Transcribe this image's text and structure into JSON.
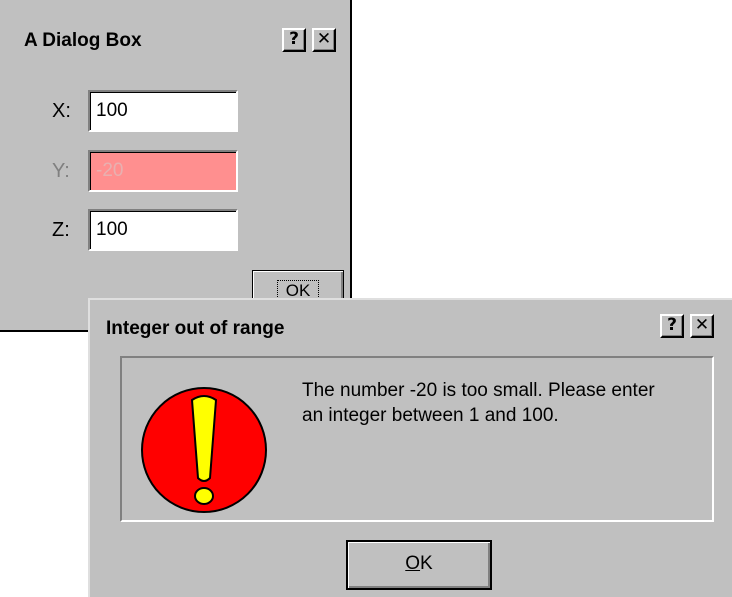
{
  "dialog_main": {
    "title": "A Dialog Box",
    "help_label": "?",
    "close_label": "✕",
    "fields": [
      {
        "label": "X:",
        "value": "100",
        "state": "normal"
      },
      {
        "label": "Y:",
        "value": "-20",
        "state": "error"
      },
      {
        "label": "Z:",
        "value": "100",
        "state": "normal"
      }
    ],
    "ok_label": "OK"
  },
  "error_dialog": {
    "title": "Integer out of range",
    "help_label": "?",
    "close_label": "✕",
    "icon": "exclamation-icon",
    "message": "The number -20 is too small.  Please enter\nan integer between 1 and 100.",
    "ok_label_mnemonic": "O",
    "ok_label_rest": "K"
  },
  "colors": {
    "dialog_bg": "#c0c0c0",
    "error_field_bg": "#ff8f8f",
    "icon_red": "#ff0000",
    "icon_yellow": "#ffff00"
  }
}
